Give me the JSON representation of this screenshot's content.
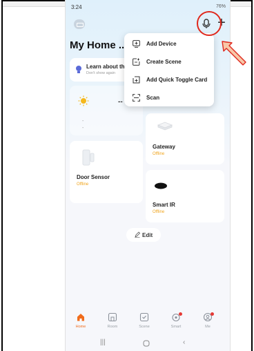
{
  "status_bar": {
    "time": "3:24",
    "icons": "76%"
  },
  "header": {
    "title": "My Home .."
  },
  "learn_card": {
    "title": "Learn about th",
    "subtitle": "Don't show again"
  },
  "weather": {
    "value": "--",
    "line1": "-",
    "line2": "-"
  },
  "dropdown": {
    "items": [
      {
        "label": "Add Device",
        "icon": "add-device-icon"
      },
      {
        "label": "Create Scene",
        "icon": "create-scene-icon"
      },
      {
        "label": "Add Quick Toggle Card",
        "icon": "quick-toggle-icon"
      },
      {
        "label": "Scan",
        "icon": "scan-icon"
      }
    ]
  },
  "devices": [
    {
      "name": "Door Sensor",
      "status": "Offline"
    },
    {
      "name": "Gateway",
      "status": "Offline"
    },
    {
      "name": "Smart IR",
      "status": "Offline"
    }
  ],
  "edit_label": "Edit",
  "bottom_nav": [
    {
      "label": "Home",
      "active": true
    },
    {
      "label": "Room",
      "active": false
    },
    {
      "label": "Scene",
      "active": false
    },
    {
      "label": "Smart",
      "active": false
    },
    {
      "label": "Me",
      "active": false
    }
  ],
  "colors": {
    "accent": "#f06c1c",
    "offline": "#f0a41c",
    "annotation": "#e0281c"
  }
}
